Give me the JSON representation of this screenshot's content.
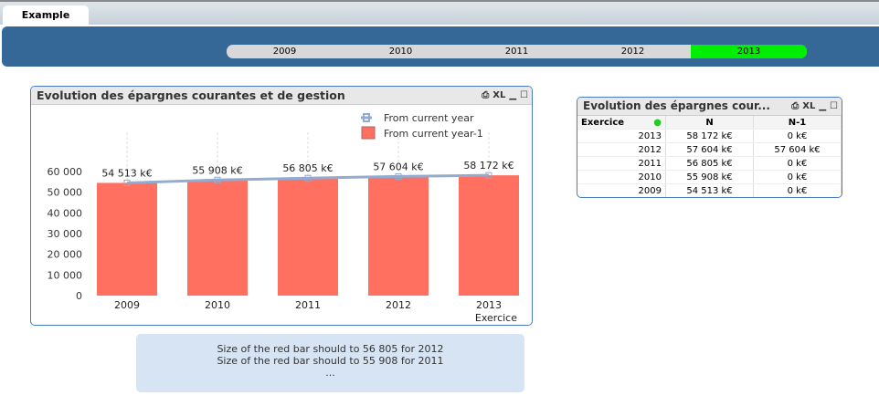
{
  "tabs": [
    {
      "label": "Example"
    }
  ],
  "years": {
    "items": [
      "2009",
      "2010",
      "2011",
      "2012",
      "2013"
    ],
    "selected": "2013"
  },
  "chart_box": {
    "title": "Evolution des épargnes courantes et de gestion",
    "icons": [
      "print-icon",
      "xl-export-icon",
      "minimize-icon",
      "maximize-icon"
    ],
    "xl": "XL"
  },
  "chart_data": {
    "type": "bar",
    "title": "Evolution des épargnes courantes et de gestion",
    "xlabel": "Exercice",
    "ylabel": "",
    "categories": [
      "2009",
      "2010",
      "2011",
      "2012",
      "2013"
    ],
    "series": [
      {
        "name": "From current year",
        "kind": "line",
        "values": [
          54513,
          55908,
          56805,
          57604,
          58172
        ],
        "labels": [
          "54 513 k€",
          "55 908 k€",
          "56 805 k€",
          "57 604 k€",
          "58 172 k€"
        ]
      },
      {
        "name": "From current year-1",
        "kind": "bar",
        "values": [
          54513,
          55908,
          56805,
          57604,
          58172
        ]
      }
    ],
    "ylim": [
      0,
      60000
    ],
    "yticks": [
      "0",
      "10 000",
      "20 000",
      "30 000",
      "40 000",
      "50 000",
      "60 000"
    ],
    "legend": "top-right",
    "colors": {
      "bar": "#ff7060",
      "line": "#93abcf"
    }
  },
  "table_box": {
    "title": "Evolution des épargnes cour...",
    "xl": "XL",
    "headers": [
      "Exercice",
      "N",
      "N-1"
    ],
    "rows": [
      [
        "2013",
        "58 172 k€",
        "0 k€"
      ],
      [
        "2012",
        "57 604 k€",
        "57 604 k€"
      ],
      [
        "2011",
        "56 805 k€",
        "0 k€"
      ],
      [
        "2010",
        "55 908 k€",
        "0 k€"
      ],
      [
        "2009",
        "54 513 k€",
        "0 k€"
      ]
    ]
  },
  "note": {
    "lines": [
      "Size of the red bar should to 56 805 for 2012",
      "Size of the red bar should to 55 908 for 2011",
      "..."
    ]
  }
}
